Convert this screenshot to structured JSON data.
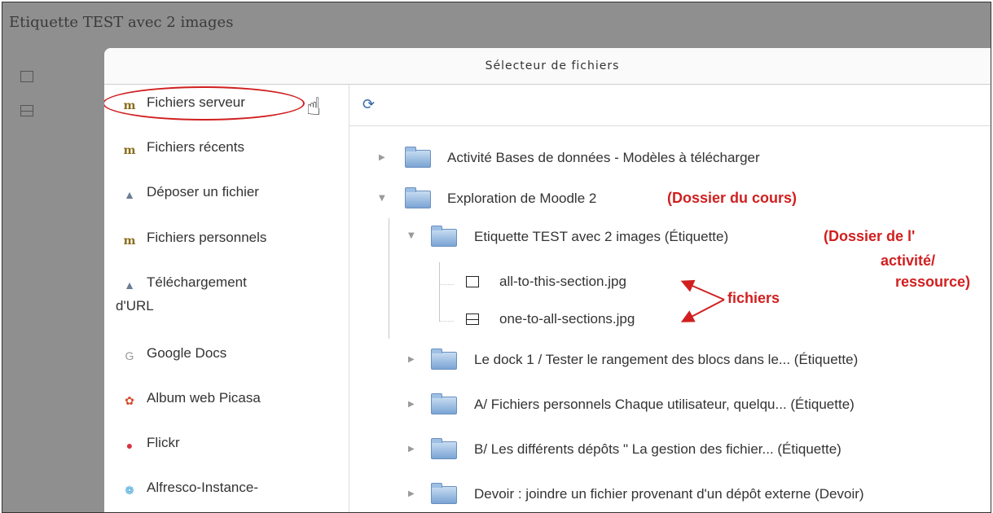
{
  "page": {
    "title": "Etiquette TEST avec 2 images"
  },
  "dialog": {
    "title": "Sélecteur de fichiers"
  },
  "sidebar": {
    "items": [
      {
        "label": "Fichiers serveur",
        "icon": "moodle-icon"
      },
      {
        "label": "Fichiers récents",
        "icon": "moodle-icon"
      },
      {
        "label": "Déposer un fichier",
        "icon": "upload-icon"
      },
      {
        "label": "Fichiers personnels",
        "icon": "moodle-icon"
      },
      {
        "label": "Téléchargement",
        "label2": "d'URL",
        "icon": "upload-icon"
      },
      {
        "label": "Google Docs",
        "icon": "google-icon"
      },
      {
        "label": "Album web Picasa",
        "icon": "picasa-icon"
      },
      {
        "label": "Flickr",
        "icon": "flickr-icon"
      },
      {
        "label": "Alfresco-Instance-",
        "icon": "alfresco-icon"
      }
    ]
  },
  "tree": {
    "items": [
      {
        "label": "Activité Bases de données - Modèles à télécharger"
      },
      {
        "label": "Exploration de Moodle 2"
      },
      {
        "label": "Etiquette TEST avec 2 images (Étiquette)"
      },
      {
        "label": "all-to-this-section.jpg"
      },
      {
        "label": "one-to-all-sections.jpg"
      },
      {
        "label": "Le dock 1 / Tester le rangement des blocs dans le... (Étiquette)"
      },
      {
        "label": "A/ Fichiers personnels Chaque utilisateur, quelqu... (Étiquette)"
      },
      {
        "label": "B/ Les différents dépôts \" La gestion des fichier... (Étiquette)"
      },
      {
        "label": "Devoir : joindre un fichier provenant d'un dépôt externe (Devoir)"
      }
    ]
  },
  "annotations": {
    "course_folder": "(Dossier du cours)",
    "activity_folder_1": "(Dossier de l'",
    "activity_folder_2": "activité/",
    "activity_folder_3": "ressource)",
    "files": "fichiers"
  },
  "colors": {
    "annotation": "#d11f1f",
    "background": "#8f8f8f",
    "folder": "#7aa4d4"
  }
}
